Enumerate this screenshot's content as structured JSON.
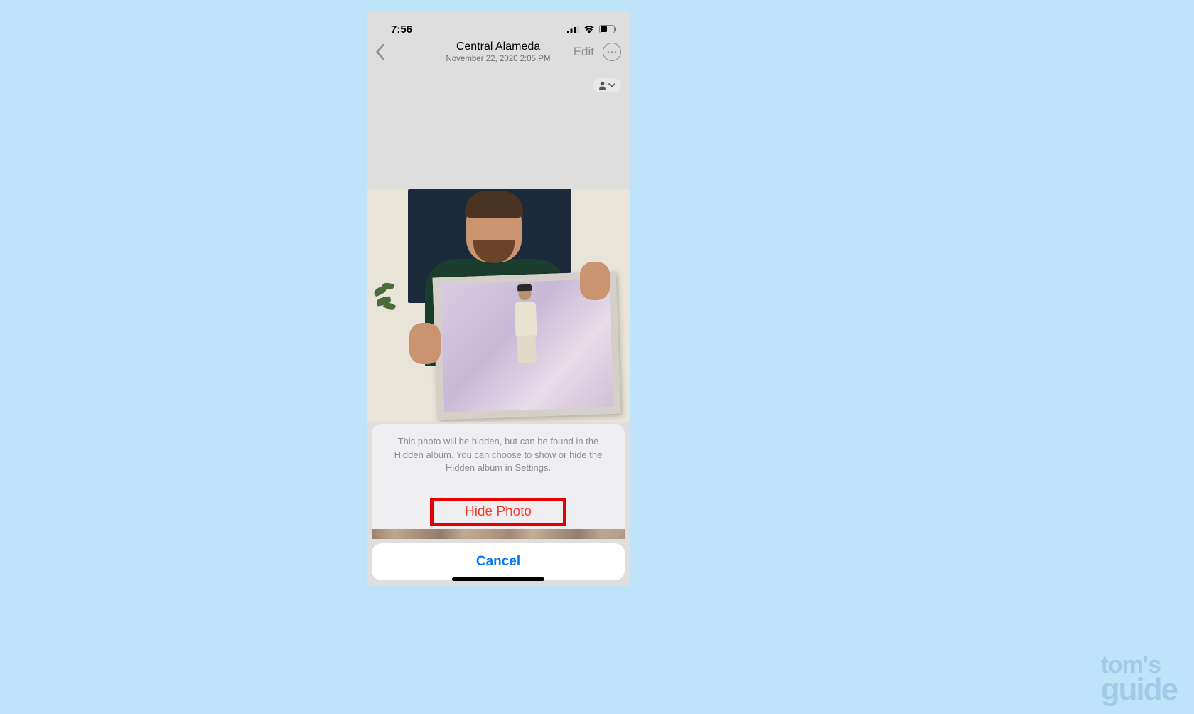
{
  "status": {
    "time": "7:56"
  },
  "nav": {
    "title": "Central Alameda",
    "subtitle": "November 22, 2020  2:05 PM",
    "edit_label": "Edit"
  },
  "sheet": {
    "message": "This photo will be hidden, but can be found in the Hidden album. You can choose to show or hide the Hidden album in Settings.",
    "hide_label": "Hide Photo",
    "cancel_label": "Cancel"
  },
  "watermark": {
    "line1": "tom's",
    "line2": "guide"
  }
}
